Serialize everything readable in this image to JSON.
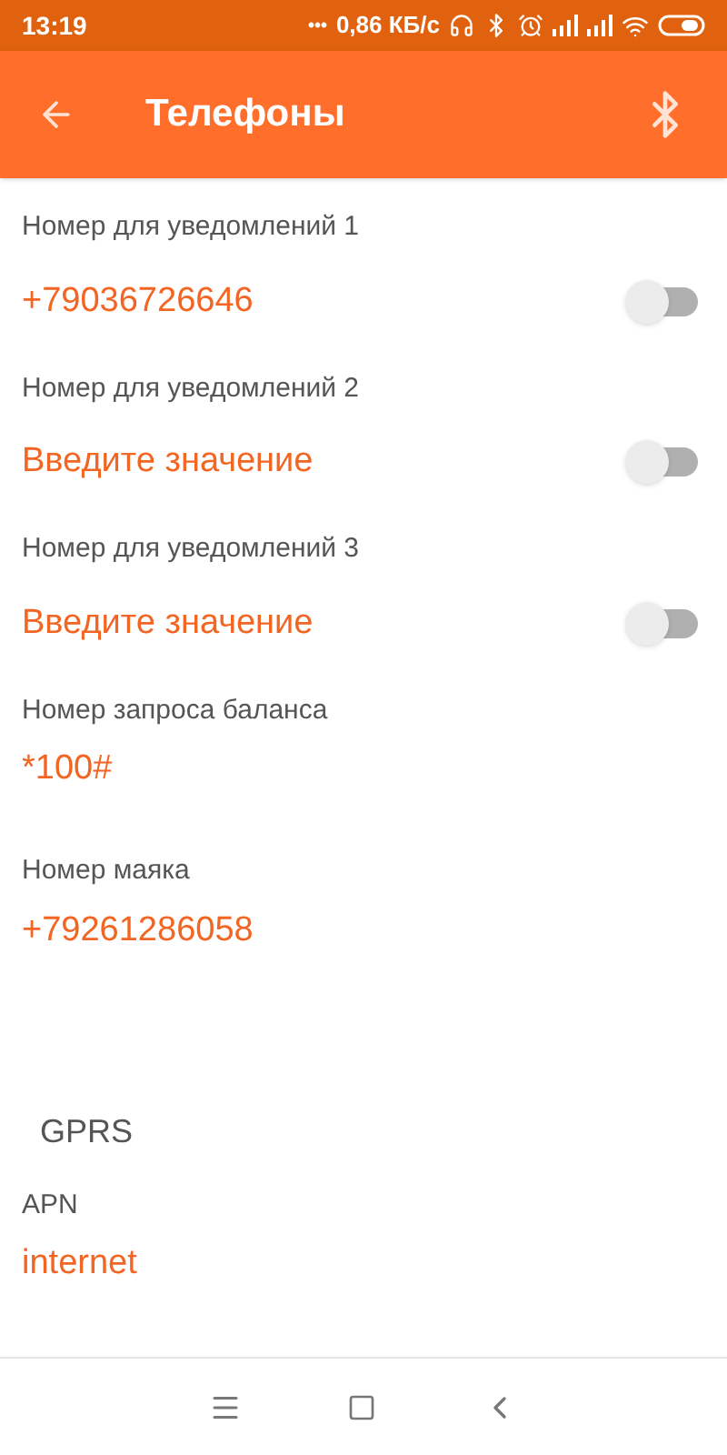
{
  "status_bar": {
    "time": "13:19",
    "dots": "•••",
    "speed": "0,86 КБ/с"
  },
  "app_bar": {
    "title": "Телефоны"
  },
  "fields": [
    {
      "kind": "switch",
      "label": "Номер для уведомлений 1",
      "value": "+79036726646",
      "on": false
    },
    {
      "kind": "switch",
      "label": "Номер для уведомлений 2",
      "placeholder": "Введите значение",
      "on": false
    },
    {
      "kind": "switch",
      "label": "Номер для уведомлений 3",
      "placeholder": "Введите значение",
      "on": false
    },
    {
      "kind": "plain",
      "label": "Номер запроса баланса",
      "value": "*100#"
    },
    {
      "kind": "plain",
      "label": "Номер маяка",
      "value": "+79261286058"
    }
  ],
  "gprs": {
    "title": "GPRS",
    "fields": [
      {
        "kind": "plain",
        "label": "APN",
        "value": "internet"
      }
    ]
  }
}
